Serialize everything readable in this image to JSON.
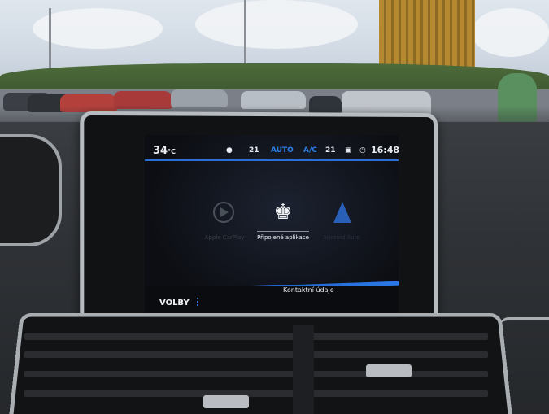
{
  "statusbar": {
    "outside_temp": "34",
    "outside_unit": "°C",
    "temp_left": "21",
    "mode": "AUTO",
    "ac": "A/C",
    "temp_right": "21",
    "clock": "16:48"
  },
  "menu": {
    "items": [
      {
        "label": "Apple CarPlay",
        "icon": "play-icon",
        "state": "inactive"
      },
      {
        "label": "Připojené aplikace",
        "icon": "peugeot-lion-icon",
        "state": "active"
      },
      {
        "label": "Android Auto",
        "icon": "navigation-arrow-icon",
        "state": "inactive"
      }
    ]
  },
  "bottombar": {
    "options_label": "VOLBY",
    "contact_label": "Kontaktní údaje"
  },
  "colors": {
    "accent_blue": "#2a6fd6",
    "text_primary": "#e8ecf2",
    "text_inactive": "#4a5058"
  }
}
